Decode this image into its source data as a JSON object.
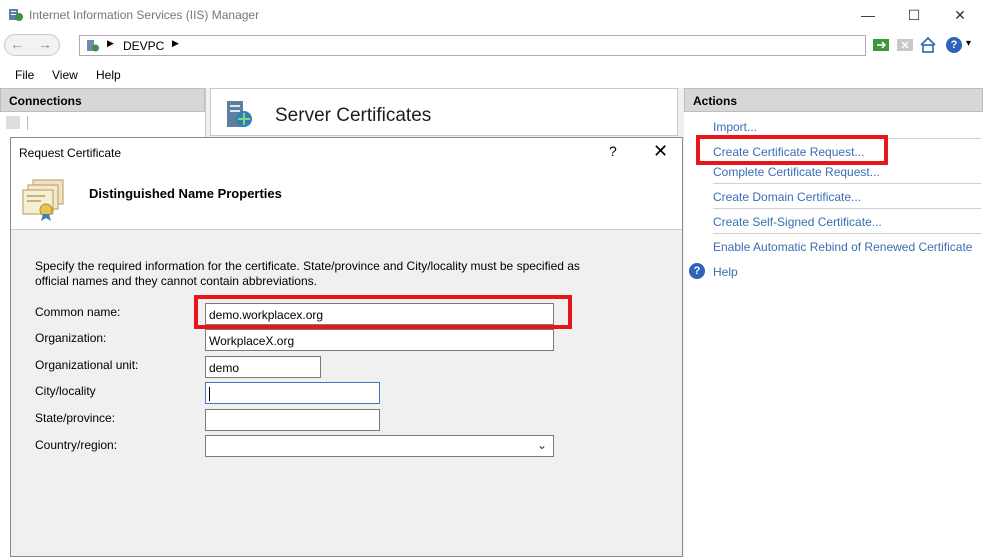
{
  "window": {
    "title": "Internet Information Services (IIS) Manager",
    "controls": {
      "minimize": "—",
      "maximize": "☐",
      "close": "✕"
    }
  },
  "address_bar": {
    "back_arrow": "←",
    "forward_arrow": "→",
    "breadcrumb": [
      "DEVPC"
    ],
    "separator": "▶",
    "help_glyph": "?",
    "help_dropdown": "▾"
  },
  "menu": [
    "File",
    "View",
    "Help"
  ],
  "connections": {
    "header": "Connections"
  },
  "feature": {
    "title": "Server Certificates"
  },
  "actions": {
    "header": "Actions",
    "items": [
      "Import...",
      "Create Certificate Request...",
      "Complete Certificate Request...",
      "Create Domain Certificate...",
      "Create Self-Signed Certificate...",
      "Enable Automatic Rebind of Renewed Certificate"
    ],
    "help": "Help",
    "help_glyph": "?"
  },
  "dialog": {
    "title": "Request Certificate",
    "help_glyph": "?",
    "close_glyph": "✕",
    "heading": "Distinguished Name Properties",
    "instructions": "Specify the required information for the certificate. State/province and City/locality must be specified as official names and they cannot contain abbreviations.",
    "fields": {
      "common_name": {
        "label": "Common name:",
        "value": "demo.workplacex.org"
      },
      "organization": {
        "label": "Organization:",
        "value": "WorkplaceX.org"
      },
      "organizational_unit": {
        "label": "Organizational unit:",
        "value": "demo"
      },
      "city": {
        "label": "City/locality",
        "value": ""
      },
      "state": {
        "label": "State/province:",
        "value": ""
      },
      "country": {
        "label": "Country/region:",
        "value": "",
        "arrow": "⌄"
      }
    }
  },
  "colors": {
    "highlight": "#e8151b",
    "link": "#3a6eb5",
    "header_bg": "#d7d7d7"
  }
}
